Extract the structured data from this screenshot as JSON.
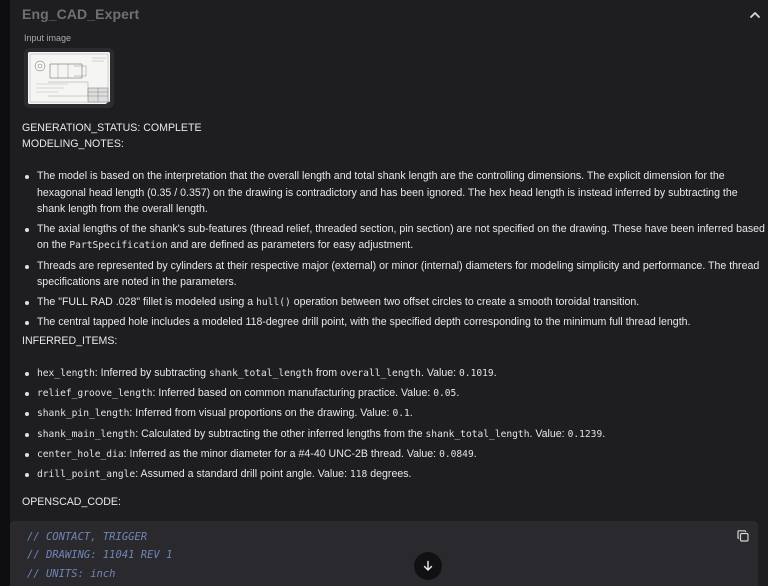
{
  "panel": {
    "title": "Eng_CAD_Expert",
    "input_label": "Input image"
  },
  "output": {
    "status_line": "GENERATION_STATUS: COMPLETE",
    "notes_title": "MODELING_NOTES:",
    "notes": [
      {
        "text": "The model is based on the interpretation that the overall length and total shank length are the controlling dimensions. The explicit dimension for the hexagonal head length (0.35 / 0.357) on the drawing is contradictory and has been ignored. The hex head length is instead inferred by subtracting the shank length from the overall length."
      },
      {
        "pre": "The axial lengths of the shank's sub-features (thread relief, threaded section, pin section) are not specified on the drawing. These have been inferred based on the ",
        "code": "PartSpecification",
        "post": " and are defined as parameters for easy adjustment."
      },
      {
        "text": "Threads are represented by cylinders at their respective major (external) or minor (internal) diameters for modeling simplicity and performance. The thread specifications are noted in the parameters."
      },
      {
        "pre": "The \"FULL RAD .028\" fillet is modeled using a ",
        "code": "hull()",
        "post": " operation between two offset circles to create a smooth toroidal transition."
      },
      {
        "text": "The central tapped hole includes a modeled 118-degree drill point, with the specified depth corresponding to the minimum full thread length."
      }
    ],
    "inferred_title": "INFERRED_ITEMS:",
    "inferred": [
      {
        "name": "hex_length",
        "desc_pre": ": Inferred by subtracting ",
        "code1": "shank_total_length",
        "mid": " from ",
        "code2": "overall_length",
        "desc_post": ". Value: ",
        "value": "0.1019",
        "tail": "."
      },
      {
        "name": "relief_groove_length",
        "desc_pre": ": Inferred based on common manufacturing practice. Value: ",
        "value": "0.05",
        "tail": "."
      },
      {
        "name": "shank_pin_length",
        "desc_pre": ": Inferred from visual proportions on the drawing. Value: ",
        "value": "0.1",
        "tail": "."
      },
      {
        "name": "shank_main_length",
        "desc_pre": ": Calculated by subtracting the other inferred lengths from the ",
        "code1": "shank_total_length",
        "desc_post": ". Value: ",
        "value": "0.1239",
        "tail": "."
      },
      {
        "name": "center_hole_dia",
        "desc_pre": ": Inferred as the minor diameter for a #4-40 UNC-2B thread. Value: ",
        "value": "0.0849",
        "tail": "."
      },
      {
        "name": "drill_point_angle",
        "desc_pre": ": Assumed a standard drill point angle. Value: ",
        "value": "118",
        "tail": " degrees."
      }
    ],
    "code_title": "OPENSCAD_CODE:",
    "code_lines": [
      "// CONTACT, TRIGGER",
      "// DRAWING: 11041 REV 1",
      "// UNITS: inch"
    ]
  },
  "icons": {
    "collapse": "chevron-up-icon",
    "download": "download-icon",
    "copy": "copy-icon",
    "scroll": "arrow-down-icon"
  }
}
